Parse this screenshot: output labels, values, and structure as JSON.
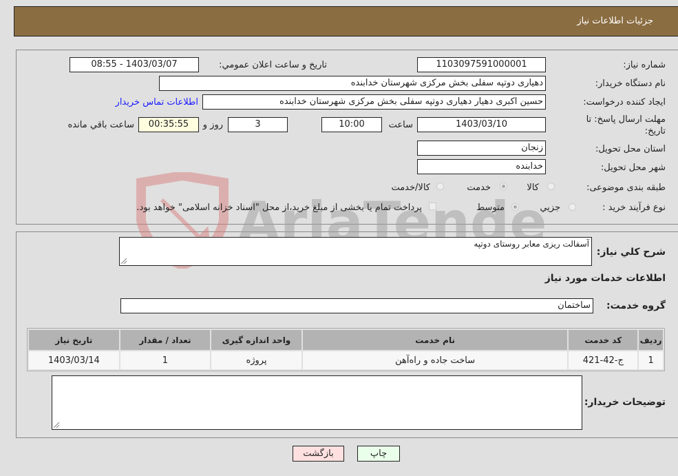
{
  "header": {
    "title": "جزئیات اطلاعات نیاز"
  },
  "form": {
    "need_number": {
      "label": "شماره نیاز:",
      "value": "1103097591000001"
    },
    "announce_datetime": {
      "label": "تاریخ و ساعت اعلان عمومي:",
      "value": "1403/03/07 - 08:55"
    },
    "buyer_org": {
      "label": "نام دستگاه خریدار:",
      "value": "دهیاری دوتپه سفلی بخش مرکزی شهرستان خدابنده"
    },
    "creator": {
      "label": "ایجاد کننده درخواست:",
      "value": "حسین اکبری دهیار دهیاری دوتپه سفلی بخش مرکزی شهرستان خدابنده"
    },
    "buyer_contact_link": "اطلاعات تماس خریدار",
    "deadline": {
      "label_line1": "مهلت ارسال پاسخ: تا",
      "label_line2": "تاریخ:",
      "date": "1403/03/10",
      "time_label": "ساعت",
      "time": "10:00",
      "days": "3",
      "days_label": "روز و",
      "remaining": "00:35:55",
      "remaining_label": "ساعت باقي مانده"
    },
    "province": {
      "label": "استان محل تحویل:",
      "value": "زنجان"
    },
    "city": {
      "label": "شهر محل تحویل:",
      "value": "خدابنده"
    },
    "category": {
      "label": "طبقه بندی موضوعی:",
      "options": [
        {
          "label": "کالا",
          "checked": false
        },
        {
          "label": "خدمت",
          "checked": true
        },
        {
          "label": "کالا/خدمت",
          "checked": false
        }
      ]
    },
    "purchase_type": {
      "label": "نوع فرآیند خرید :",
      "options": [
        {
          "label": "جزیي",
          "checked": false
        },
        {
          "label": "متوسط",
          "checked": true
        }
      ],
      "payment_note": "پرداخت تمام یا بخشی از مبلغ خرید،از محل \"اسناد خزانه اسلامی\" خواهد بود."
    }
  },
  "details": {
    "description_label": "شرح کلي نياز:",
    "description_value": "آسفالت ریزی معابر روستای دوتپه",
    "services_heading": "اطلاعات خدمات مورد نياز",
    "service_group_label": "گروه خدمت:",
    "service_group_value": "ساختمان",
    "table": {
      "headers": [
        "ردیف",
        "کد خدمت",
        "نام خدمت",
        "واحد اندازه گیری",
        "تعداد / مقدار",
        "تاریخ نیاز"
      ],
      "rows": [
        [
          "1",
          "ج-42-421",
          "ساخت جاده و راه‌آهن",
          "پروژه",
          "1",
          "1403/03/14"
        ]
      ]
    },
    "buyer_notes_label": "توضیحات خریدار:",
    "buyer_notes_value": ""
  },
  "buttons": {
    "print": "چاپ",
    "back": "بازگشت"
  },
  "watermark": {
    "text": "AriaTender.neT"
  },
  "colors": {
    "header": "#8b6d42",
    "print_bg": "#eaffea",
    "back_bg": "#ffe0e0",
    "link": "#1a1aff"
  }
}
